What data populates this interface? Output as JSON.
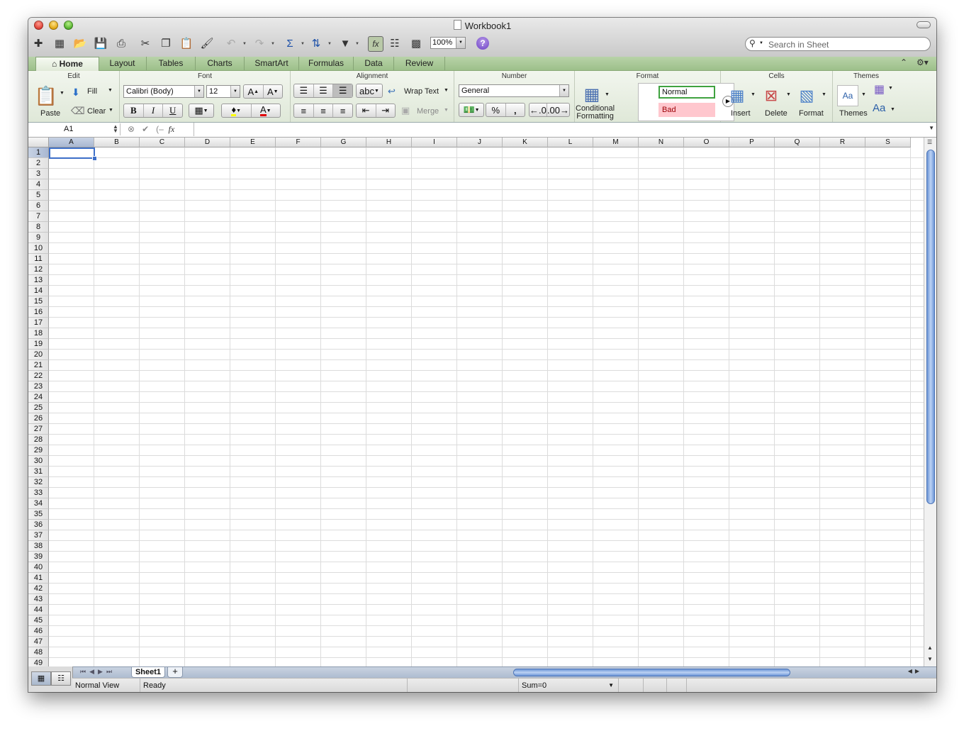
{
  "window": {
    "title": "Workbook1"
  },
  "toolbar": {
    "zoom": "100%",
    "search_placeholder": "Search in Sheet",
    "help": "?"
  },
  "tabs": [
    "Home",
    "Layout",
    "Tables",
    "Charts",
    "SmartArt",
    "Formulas",
    "Data",
    "Review"
  ],
  "ribbon": {
    "groups": {
      "edit": "Edit",
      "font": "Font",
      "alignment": "Alignment",
      "number": "Number",
      "format": "Format",
      "cells": "Cells",
      "themes": "Themes"
    },
    "edit": {
      "paste": "Paste",
      "fill": "Fill",
      "clear": "Clear"
    },
    "font": {
      "name": "Calibri (Body)",
      "size": "12",
      "bold": "B",
      "italic": "I",
      "underline": "U",
      "grow": "A",
      "shrink": "A",
      "color": "A"
    },
    "alignment": {
      "abc": "abc",
      "wrap": "Wrap Text",
      "merge": "Merge"
    },
    "number": {
      "format": "General",
      "percent": "%",
      "comma": ","
    },
    "format": {
      "cond_line1": "Conditional",
      "cond_line2": "Formatting",
      "normal": "Normal",
      "bad": "Bad"
    },
    "cells": {
      "insert": "Insert",
      "delete": "Delete",
      "format": "Format"
    },
    "themes": {
      "themes": "Themes",
      "aa": "Aa"
    }
  },
  "formula_bar": {
    "name_box": "A1",
    "fx": "fx",
    "value": ""
  },
  "grid": {
    "columns": [
      "A",
      "B",
      "C",
      "D",
      "E",
      "F",
      "G",
      "H",
      "I",
      "J",
      "K",
      "L",
      "M",
      "N",
      "O",
      "P",
      "Q",
      "R",
      "S"
    ],
    "row_count": 49,
    "active_cell": "A1"
  },
  "sheets": [
    "Sheet1"
  ],
  "sheet_add": "+",
  "status": {
    "view": "Normal View",
    "state": "Ready",
    "sum": "Sum=0"
  },
  "colors": {
    "tab_bar": "#9dc08a",
    "selection": "#3d6fc8",
    "scroll_thumb": "#6c95d6",
    "bad_fill": "#ffc7ce",
    "normal_border": "#3fa23f"
  }
}
